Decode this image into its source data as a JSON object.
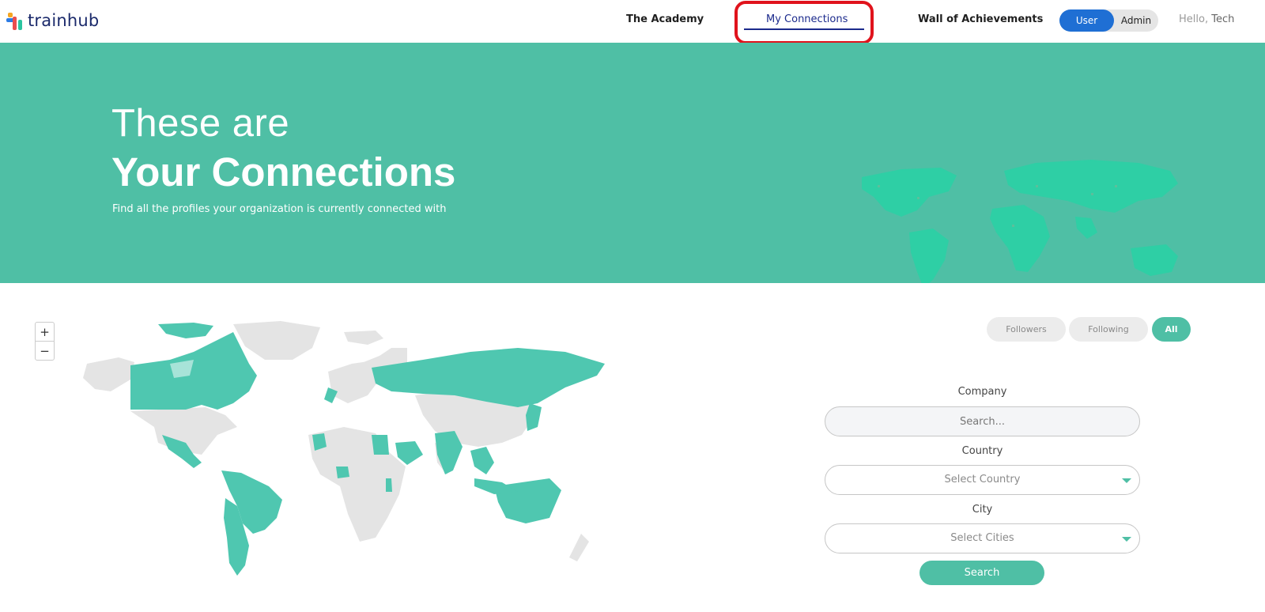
{
  "brand": {
    "name": "trainhub"
  },
  "nav": {
    "academy": "The Academy",
    "connections": "My Connections",
    "wall": "Wall of Achievements",
    "role_user": "User",
    "role_admin": "Admin",
    "hello_prefix": "Hello,",
    "hello_name": "Tech"
  },
  "hero": {
    "line1": "These are",
    "line2": "Your Connections",
    "subtitle": "Find all the profiles your organization is currently connected with"
  },
  "map": {
    "zoom_in": "+",
    "zoom_out": "−",
    "highlight_color": "#4fc7b0",
    "base_color": "#e4e4e4"
  },
  "filters": {
    "followers": "Followers",
    "following": "Following",
    "all": "All",
    "company_label": "Company",
    "company_placeholder": "Search...",
    "country_label": "Country",
    "country_value": "Select Country",
    "city_label": "City",
    "city_value": "Select Cities",
    "search_button": "Search"
  },
  "colors": {
    "accent": "#4fbfa5",
    "nav_active": "#1b2a8c",
    "toggle_active": "#1f6fd4",
    "highlight_ring": "#e0131c"
  }
}
